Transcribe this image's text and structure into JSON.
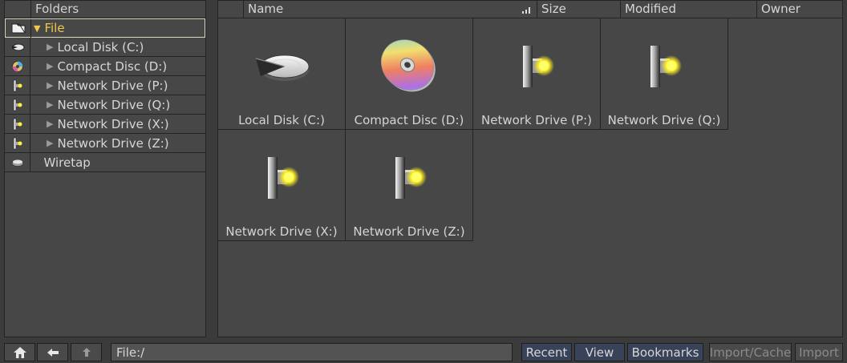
{
  "folders_panel": {
    "title": "Folders",
    "items": [
      {
        "label": "File",
        "icon": "folder-icon",
        "selected": true,
        "expanded": true,
        "level": 0
      },
      {
        "label": "Local Disk (C:)",
        "icon": "hard-disk-icon",
        "level": 1
      },
      {
        "label": "Compact Disc (D:)",
        "icon": "compact-disc-icon",
        "level": 1
      },
      {
        "label": "Network Drive (P:)",
        "icon": "network-drive-icon",
        "level": 1
      },
      {
        "label": "Network Drive (Q:)",
        "icon": "network-drive-icon",
        "level": 1
      },
      {
        "label": "Network Drive (X:)",
        "icon": "network-drive-icon",
        "level": 1
      },
      {
        "label": "Network Drive (Z:)",
        "icon": "network-drive-icon",
        "level": 1
      },
      {
        "label": "Wiretap",
        "icon": "wiretap-icon",
        "level": 0
      }
    ]
  },
  "columns": {
    "name": "Name",
    "size": "Size",
    "modified": "Modified",
    "owner": "Owner"
  },
  "tiles": [
    {
      "label": "Local Disk (C:)",
      "icon": "hard-disk-icon"
    },
    {
      "label": "Compact Disc (D:)",
      "icon": "compact-disc-icon"
    },
    {
      "label": "Network Drive (P:)",
      "icon": "network-drive-icon"
    },
    {
      "label": "Network Drive (Q:)",
      "icon": "network-drive-icon"
    },
    {
      "label": "Network Drive (X:)",
      "icon": "network-drive-icon"
    },
    {
      "label": "Network Drive (Z:)",
      "icon": "network-drive-icon"
    }
  ],
  "bottom_bar": {
    "path_value": "File:/",
    "recent_label": "Recent",
    "view_label": "View",
    "bookmarks_label": "Bookmarks",
    "import_cache_label": "Import/Cache",
    "import_label": "Import"
  },
  "colors": {
    "selected_text": "#f0c84a",
    "panel_bg": "#474747",
    "accent_button": "#38435a"
  }
}
